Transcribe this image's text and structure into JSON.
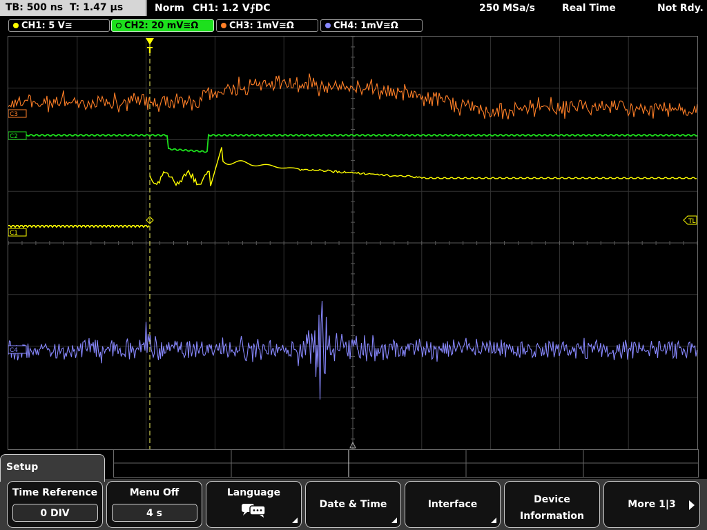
{
  "status": {
    "timebase": "TB: 500 ns",
    "trigger_pos": "T: 1.47 µs",
    "mode": "Norm",
    "trigger_source": "CH1: 1.2 V",
    "trigger_slope": "⨍",
    "trigger_coupling": "DC",
    "sample_rate": "250 MSa/s",
    "acq_mode": "Real Time",
    "state": "Not Rdy."
  },
  "channels": [
    {
      "label": "CH1: 5 V≅",
      "color": "#ffff00"
    },
    {
      "label": "CH2: 20 mV≅Ω",
      "color": "#1de01d"
    },
    {
      "label": "CH3: 1mV≅Ω",
      "color": "#ff7f27"
    },
    {
      "label": "CH4: 1mV≅Ω",
      "color": "#8888ff"
    }
  ],
  "markers": {
    "c1": "C1",
    "c2": "C2",
    "c3": "C3",
    "c4": "C4",
    "trigger_level": "TL",
    "trigger": "T"
  },
  "menu": {
    "title": "Setup",
    "keys": [
      {
        "title": "Time Reference",
        "value": "0 DIV"
      },
      {
        "title": "Menu Off",
        "value": "4 s"
      },
      {
        "title": "Language",
        "icon": "speech-bubbles-icon"
      },
      {
        "title": "Date & Time"
      },
      {
        "title": "Interface"
      },
      {
        "title": "Device",
        "title2": "Information"
      },
      {
        "title": "More 1|3"
      }
    ]
  }
}
